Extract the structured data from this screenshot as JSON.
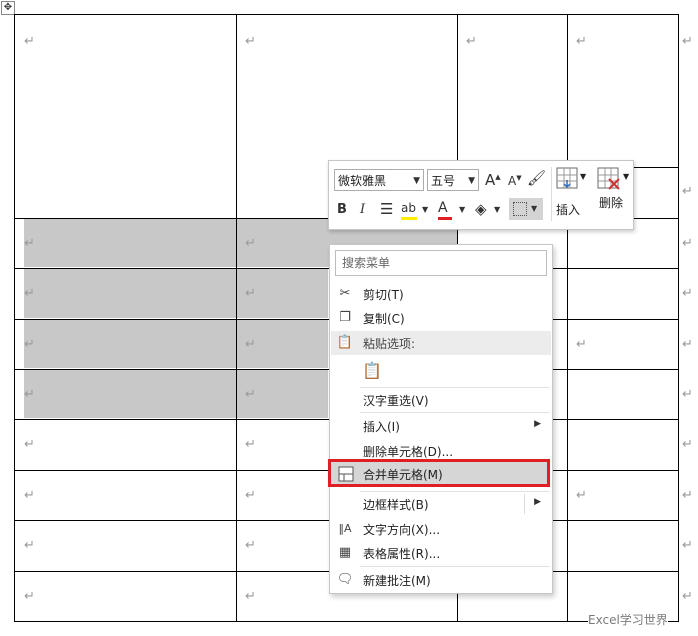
{
  "paragraph_mark": "↵",
  "toolbar": {
    "font_name": "微软雅黑",
    "font_size": "五号",
    "grow_font": "A",
    "shrink_font": "A",
    "bold": "B",
    "italic": "I",
    "font_color_letter": "A",
    "insert_label": "插入",
    "delete_label": "删除"
  },
  "menu": {
    "search_placeholder": "搜索菜单",
    "items": {
      "cut": "剪切(T)",
      "copy": "复制(C)",
      "paste_options": "粘贴选项:",
      "reconvert": "汉字重选(V)",
      "insert": "插入(I)",
      "delete_cells": "删除单元格(D)...",
      "merge_cells": "合并单元格(M)",
      "border_styles": "边框样式(B)",
      "text_direction": "文字方向(X)...",
      "table_properties": "表格属性(R)...",
      "new_comment": "新建批注(M)"
    }
  },
  "watermark": "Excel学习世界",
  "colors": {
    "highlight_border": "#e01e25",
    "selection_shade": "#c8c8c8",
    "highlight_yellow": "#ffee00",
    "font_red": "#e01e25"
  }
}
